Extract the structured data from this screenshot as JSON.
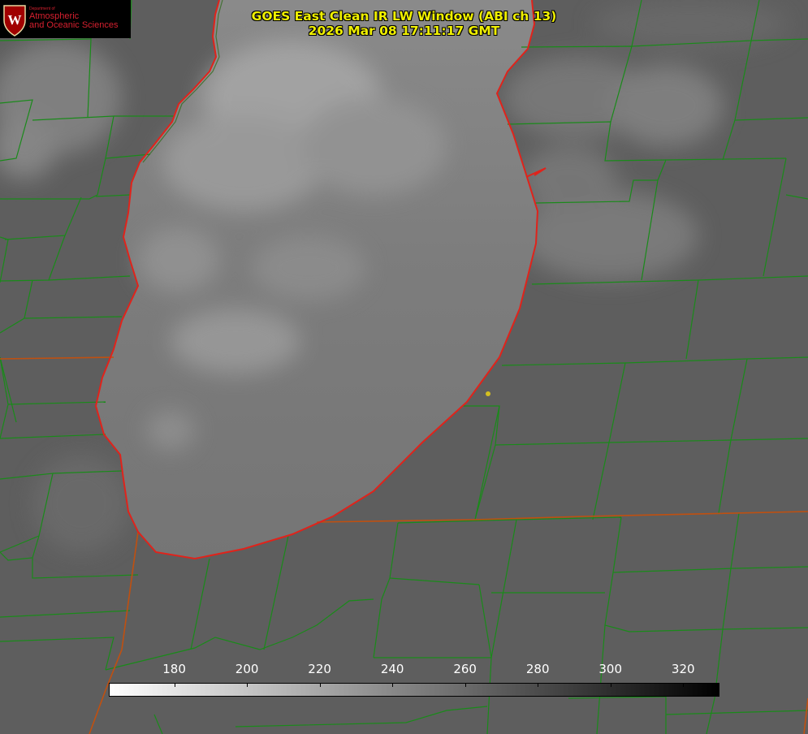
{
  "logo": {
    "department": "Department of",
    "line1": "Atmospheric",
    "line2": "and Oceanic Sciences",
    "colors": {
      "background": "#000000",
      "text": "#d6202f",
      "crest": "#a00000"
    }
  },
  "title": {
    "line1": "GOES East Clean IR LW Window (ABI ch 13)",
    "line2": "2026 Mar 08 17:11:17 GMT",
    "color": "#f0f000"
  },
  "colorbar": {
    "min": 162,
    "max": 330,
    "ticks": [
      "180",
      "200",
      "220",
      "240",
      "260",
      "280",
      "300",
      "320"
    ],
    "gradient": [
      "#ffffff",
      "#000000"
    ]
  },
  "map": {
    "feature_icon": "lake-michigan-outline",
    "colors": {
      "coastline": "#e0231b",
      "county_lines": "#1a8a1a",
      "state_lines": "#c05010",
      "marker": "#d4c020"
    }
  }
}
